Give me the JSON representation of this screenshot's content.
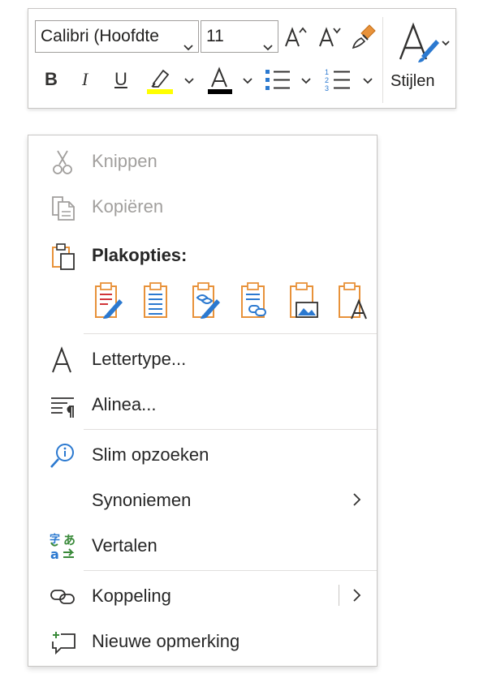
{
  "toolbar": {
    "font_name": "Calibri (Hoofdte",
    "font_size": "11",
    "styles_label": "Stijlen",
    "highlight_color": "#ffff00",
    "font_color": "#000000",
    "icons": [
      "grow-font-icon",
      "shrink-font-icon",
      "format-painter-icon",
      "bold-icon",
      "italic-icon",
      "underline-icon",
      "highlight-icon",
      "font-color-icon",
      "bullets-icon",
      "numbering-icon",
      "styles-icon"
    ]
  },
  "menu": {
    "cut": "Knippen",
    "copy": "Kopiëren",
    "paste_options": "Plakopties:",
    "font": "Lettertype...",
    "paragraph": "Alinea...",
    "smart_lookup": "Slim opzoeken",
    "synonyms": "Synoniemen",
    "translate": "Vertalen",
    "link": "Koppeling",
    "new_comment": "Nieuwe opmerking"
  },
  "colors": {
    "accent_blue": "#2b79d0",
    "accent_orange": "#e8923a",
    "disabled_text": "#a19f9d",
    "green": "#3a8a3a"
  }
}
